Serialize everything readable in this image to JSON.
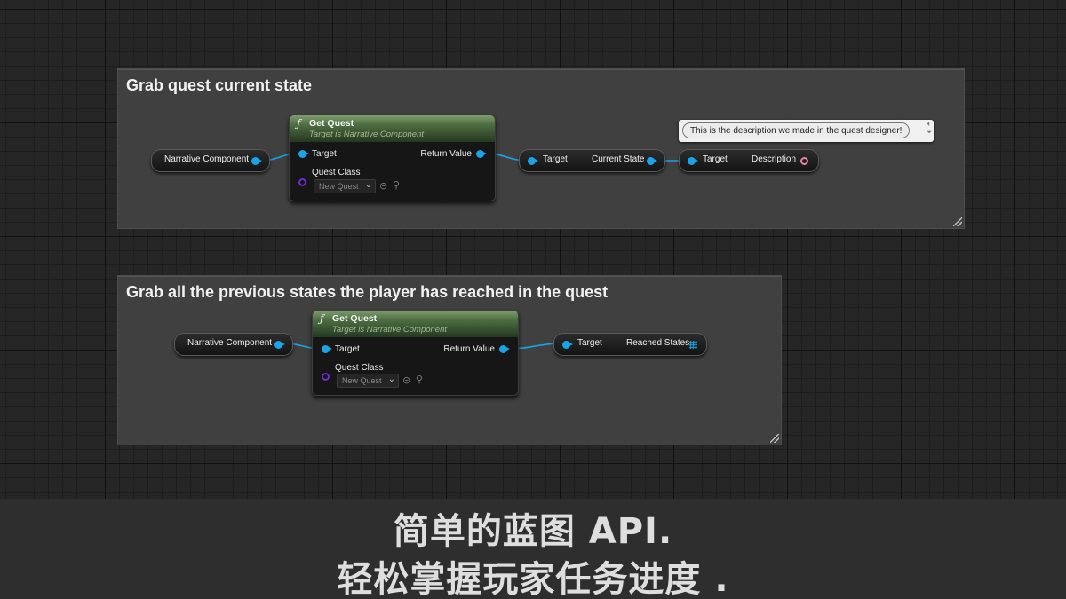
{
  "comments": [
    {
      "title": "Grab quest current state"
    },
    {
      "title": "Grab all the previous states the player has reached in the quest"
    }
  ],
  "graph1": {
    "narrative_component": "Narrative Component",
    "get_quest": {
      "title": "Get Quest",
      "subtitle": "Target is Narrative Component",
      "target_pin": "Target",
      "return_pin": "Return Value",
      "class_pin": "Quest Class",
      "class_value": "New Quest"
    },
    "current_state_node": {
      "target": "Target",
      "output": "Current State"
    },
    "description_node": {
      "target": "Target",
      "output": "Description"
    },
    "tooltip": "This is the description we made in the quest designer!"
  },
  "graph2": {
    "narrative_component": "Narrative Component",
    "get_quest": {
      "title": "Get Quest",
      "subtitle": "Target is Narrative Component",
      "target_pin": "Target",
      "return_pin": "Return Value",
      "class_pin": "Quest Class",
      "class_value": "New Quest"
    },
    "reached_states_node": {
      "target": "Target",
      "output": "Reached States"
    }
  },
  "subtitles": [
    "简单的蓝图 API.",
    "轻松掌握玩家任务进度 ."
  ],
  "colors": {
    "object_pin": "#1aa3e6",
    "class_pin": "#6b2ec8",
    "text_pin": "#e385a6",
    "function_header": "#4d6e42"
  },
  "icons": {
    "function": "function-icon",
    "dropdown": "chevron-down-icon",
    "browse": "arrow-left-circle-icon",
    "search": "search-icon"
  }
}
